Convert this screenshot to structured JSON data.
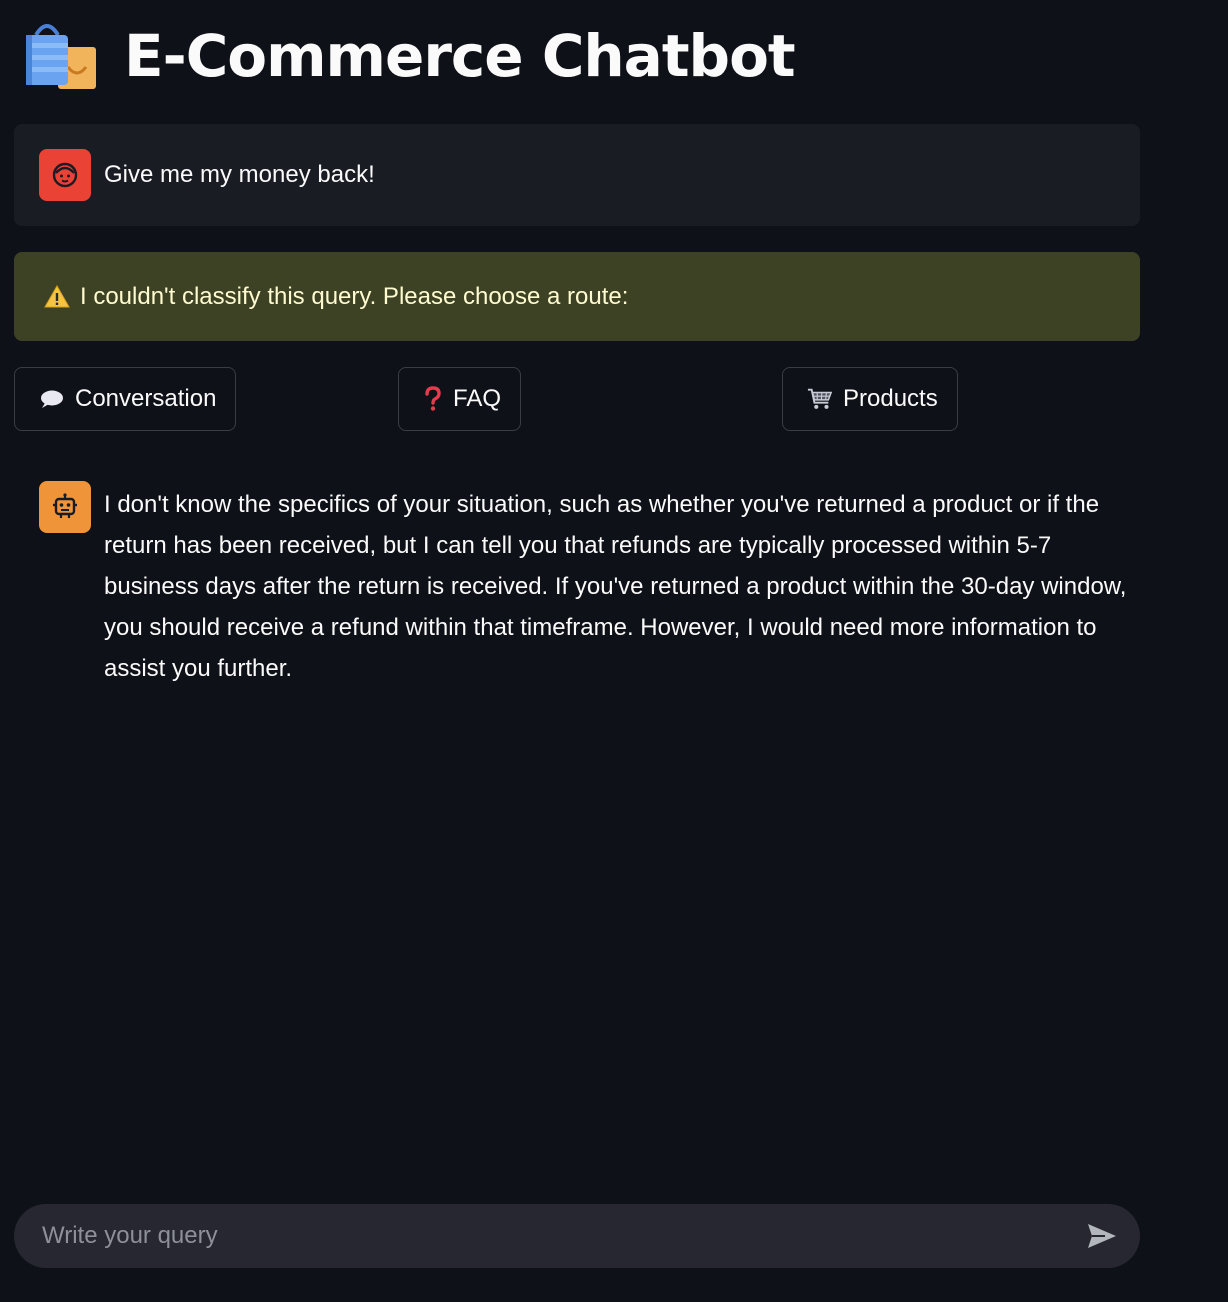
{
  "header": {
    "title": "E-Commerce Chatbot",
    "icon": "shopping-bags-icon"
  },
  "messages": {
    "user": {
      "avatar_icon": "user-face-icon",
      "text": "Give me my money back!"
    },
    "warning": {
      "icon": "warning-icon",
      "text": "I couldn't classify this query. Please choose a route:"
    },
    "routes": [
      {
        "label": "Conversation",
        "icon": "speech-bubble-icon"
      },
      {
        "label": "FAQ",
        "icon": "question-mark-icon"
      },
      {
        "label": "Products",
        "icon": "shopping-cart-icon"
      }
    ],
    "bot": {
      "avatar_icon": "robot-icon",
      "text": "I don't know the specifics of your situation, such as whether you've returned a product or if the return has been received, but I can tell you that refunds are typically processed within 5-7 business days after the return is received. If you've returned a product within the 30-day window, you should receive a refund within that timeframe. However, I would need more information to assist you further."
    }
  },
  "chat_input": {
    "placeholder": "Write your query",
    "value": "",
    "send_icon": "send-icon"
  },
  "colors": {
    "background": "#0e1117",
    "user_avatar": "#ea4335",
    "bot_avatar": "#f0943a",
    "warning_bg": "#3d4224",
    "warning_text": "#fffbd0"
  }
}
